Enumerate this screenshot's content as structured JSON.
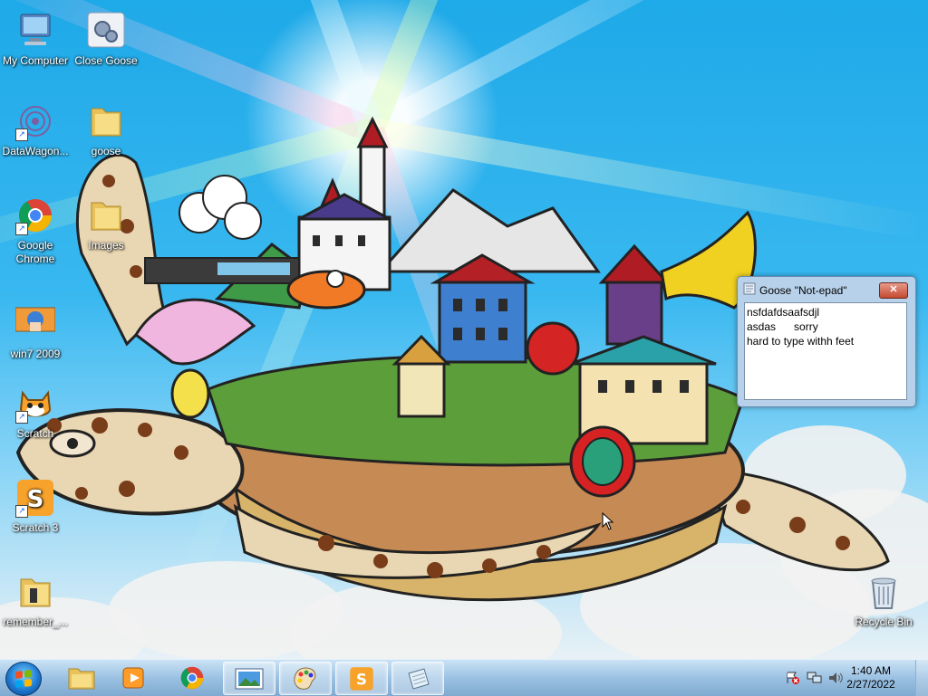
{
  "desktop_icons": [
    {
      "name": "my-computer",
      "label": "My Computer",
      "icon": "computer-icon",
      "shortcut": false
    },
    {
      "name": "close-goose",
      "label": "Close Goose",
      "icon": "gears-icon",
      "shortcut": false
    },
    {
      "name": "datawagon",
      "label": "DataWagon...",
      "icon": "spiral-icon",
      "shortcut": true
    },
    {
      "name": "goose-folder",
      "label": "goose",
      "icon": "folder-icon",
      "shortcut": false
    },
    {
      "name": "google-chrome",
      "label": "Google Chrome",
      "icon": "chrome-icon",
      "shortcut": true
    },
    {
      "name": "images-folder",
      "label": "Images",
      "icon": "folder-icon",
      "shortcut": false
    },
    {
      "name": "win7-2009",
      "label": "win7 2009",
      "icon": "image-thumbnail-icon",
      "shortcut": false
    },
    {
      "name": "scratch",
      "label": "Scratch",
      "icon": "scratch-cat-icon",
      "shortcut": true
    },
    {
      "name": "scratch-3",
      "label": "Scratch 3",
      "icon": "scratch3-icon",
      "shortcut": true
    },
    {
      "name": "remember",
      "label": "remember_...",
      "icon": "folder-icon",
      "shortcut": false
    },
    {
      "name": "recycle-bin",
      "label": "Recycle Bin",
      "icon": "recycle-bin-icon",
      "shortcut": false
    }
  ],
  "notepad": {
    "title": "Goose \"Not-epad\"",
    "close_label": "✕",
    "lines": [
      "nsfdafdsaafsdjl",
      "asdas      sorry",
      "hard to type withh feet"
    ]
  },
  "taskbar": {
    "apps": [
      {
        "name": "explorer",
        "icon": "folder-icon"
      },
      {
        "name": "media-player",
        "icon": "media-player-icon"
      },
      {
        "name": "chrome",
        "icon": "chrome-icon"
      },
      {
        "name": "photo-viewer",
        "icon": "picture-icon"
      },
      {
        "name": "paint",
        "icon": "paint-palette-icon"
      },
      {
        "name": "scratch-3",
        "icon": "scratch3-icon"
      },
      {
        "name": "notepad",
        "icon": "notepad-icon"
      }
    ],
    "clock": {
      "time": "1:40 AM",
      "date": "2/27/2022"
    }
  },
  "colors": {
    "sky": "#1ea9e8",
    "taskbar": "#9cc3e3",
    "close_red": "#c44a30"
  }
}
